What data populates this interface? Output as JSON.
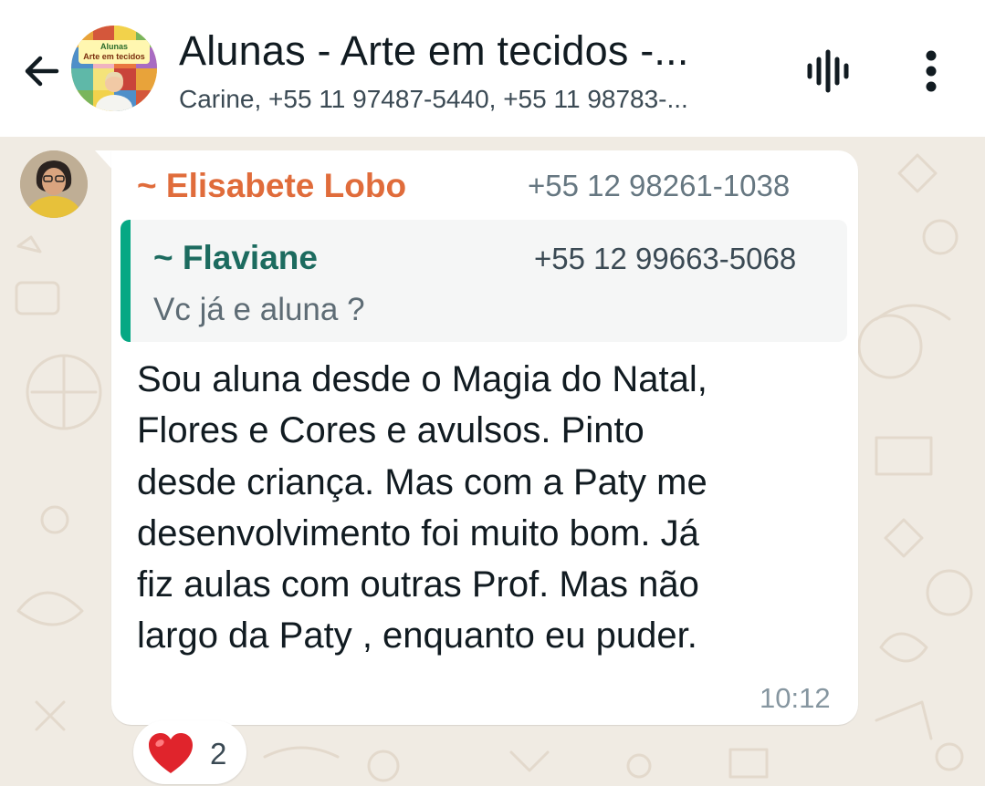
{
  "header": {
    "back_icon": "arrow-left-icon",
    "group_title": "Alunas - Arte em tecidos -...",
    "group_subtitle": "Carine, +55 11 97487-5440, +55 11 98783-...",
    "avatar_text_line1": "Alunas",
    "avatar_text_line2": "Arte em tecidos",
    "voice_icon": "audio-waveform-icon",
    "menu_icon": "more-vertical-icon"
  },
  "message": {
    "sender_name": "~ Elisabete Lobo",
    "sender_phone": "+55 12 98261-1038",
    "quoted": {
      "name": "~ Flaviane",
      "phone": "+55 12 99663-5068",
      "text": "Vc já e aluna ?"
    },
    "lines": [
      "Sou aluna desde o Magia do Natal,",
      "Flores e Cores e avulsos. Pinto",
      "desde criança. Mas com a Paty me",
      "desenvolvimento foi muito bom. Já",
      "fiz aulas com outras Prof. Mas não",
      "largo da Paty , enquanto eu puder."
    ],
    "time": "10:12",
    "reaction": {
      "emoji_icon": "red-heart-icon",
      "count": "2"
    }
  },
  "colors": {
    "sender_name": "#e06c3b",
    "quote_name": "#1c6b5f",
    "quote_bar": "#06a884",
    "chat_background": "#f0ebe3",
    "bubble": "#ffffff"
  }
}
